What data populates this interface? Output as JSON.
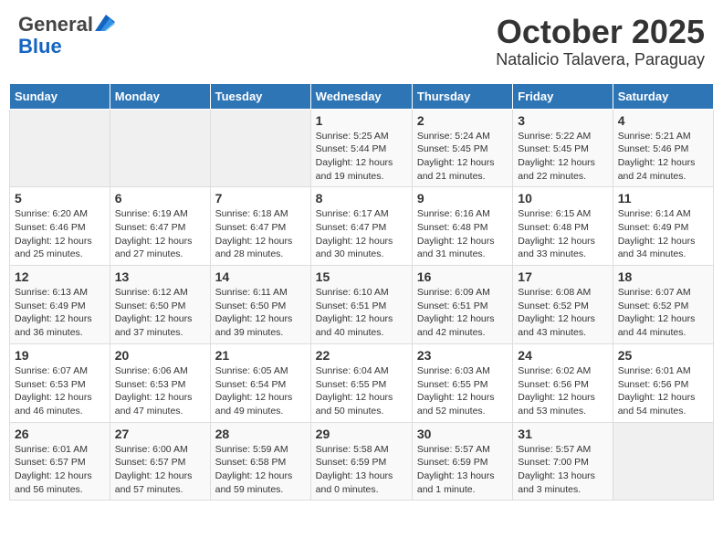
{
  "header": {
    "logo_general": "General",
    "logo_blue": "Blue",
    "title": "October 2025",
    "subtitle": "Natalicio Talavera, Paraguay"
  },
  "calendar": {
    "days_of_week": [
      "Sunday",
      "Monday",
      "Tuesday",
      "Wednesday",
      "Thursday",
      "Friday",
      "Saturday"
    ],
    "weeks": [
      [
        {
          "day": "",
          "info": ""
        },
        {
          "day": "",
          "info": ""
        },
        {
          "day": "",
          "info": ""
        },
        {
          "day": "1",
          "info": "Sunrise: 5:25 AM\nSunset: 5:44 PM\nDaylight: 12 hours\nand 19 minutes."
        },
        {
          "day": "2",
          "info": "Sunrise: 5:24 AM\nSunset: 5:45 PM\nDaylight: 12 hours\nand 21 minutes."
        },
        {
          "day": "3",
          "info": "Sunrise: 5:22 AM\nSunset: 5:45 PM\nDaylight: 12 hours\nand 22 minutes."
        },
        {
          "day": "4",
          "info": "Sunrise: 5:21 AM\nSunset: 5:46 PM\nDaylight: 12 hours\nand 24 minutes."
        }
      ],
      [
        {
          "day": "5",
          "info": "Sunrise: 6:20 AM\nSunset: 6:46 PM\nDaylight: 12 hours\nand 25 minutes."
        },
        {
          "day": "6",
          "info": "Sunrise: 6:19 AM\nSunset: 6:47 PM\nDaylight: 12 hours\nand 27 minutes."
        },
        {
          "day": "7",
          "info": "Sunrise: 6:18 AM\nSunset: 6:47 PM\nDaylight: 12 hours\nand 28 minutes."
        },
        {
          "day": "8",
          "info": "Sunrise: 6:17 AM\nSunset: 6:47 PM\nDaylight: 12 hours\nand 30 minutes."
        },
        {
          "day": "9",
          "info": "Sunrise: 6:16 AM\nSunset: 6:48 PM\nDaylight: 12 hours\nand 31 minutes."
        },
        {
          "day": "10",
          "info": "Sunrise: 6:15 AM\nSunset: 6:48 PM\nDaylight: 12 hours\nand 33 minutes."
        },
        {
          "day": "11",
          "info": "Sunrise: 6:14 AM\nSunset: 6:49 PM\nDaylight: 12 hours\nand 34 minutes."
        }
      ],
      [
        {
          "day": "12",
          "info": "Sunrise: 6:13 AM\nSunset: 6:49 PM\nDaylight: 12 hours\nand 36 minutes."
        },
        {
          "day": "13",
          "info": "Sunrise: 6:12 AM\nSunset: 6:50 PM\nDaylight: 12 hours\nand 37 minutes."
        },
        {
          "day": "14",
          "info": "Sunrise: 6:11 AM\nSunset: 6:50 PM\nDaylight: 12 hours\nand 39 minutes."
        },
        {
          "day": "15",
          "info": "Sunrise: 6:10 AM\nSunset: 6:51 PM\nDaylight: 12 hours\nand 40 minutes."
        },
        {
          "day": "16",
          "info": "Sunrise: 6:09 AM\nSunset: 6:51 PM\nDaylight: 12 hours\nand 42 minutes."
        },
        {
          "day": "17",
          "info": "Sunrise: 6:08 AM\nSunset: 6:52 PM\nDaylight: 12 hours\nand 43 minutes."
        },
        {
          "day": "18",
          "info": "Sunrise: 6:07 AM\nSunset: 6:52 PM\nDaylight: 12 hours\nand 44 minutes."
        }
      ],
      [
        {
          "day": "19",
          "info": "Sunrise: 6:07 AM\nSunset: 6:53 PM\nDaylight: 12 hours\nand 46 minutes."
        },
        {
          "day": "20",
          "info": "Sunrise: 6:06 AM\nSunset: 6:53 PM\nDaylight: 12 hours\nand 47 minutes."
        },
        {
          "day": "21",
          "info": "Sunrise: 6:05 AM\nSunset: 6:54 PM\nDaylight: 12 hours\nand 49 minutes."
        },
        {
          "day": "22",
          "info": "Sunrise: 6:04 AM\nSunset: 6:55 PM\nDaylight: 12 hours\nand 50 minutes."
        },
        {
          "day": "23",
          "info": "Sunrise: 6:03 AM\nSunset: 6:55 PM\nDaylight: 12 hours\nand 52 minutes."
        },
        {
          "day": "24",
          "info": "Sunrise: 6:02 AM\nSunset: 6:56 PM\nDaylight: 12 hours\nand 53 minutes."
        },
        {
          "day": "25",
          "info": "Sunrise: 6:01 AM\nSunset: 6:56 PM\nDaylight: 12 hours\nand 54 minutes."
        }
      ],
      [
        {
          "day": "26",
          "info": "Sunrise: 6:01 AM\nSunset: 6:57 PM\nDaylight: 12 hours\nand 56 minutes."
        },
        {
          "day": "27",
          "info": "Sunrise: 6:00 AM\nSunset: 6:57 PM\nDaylight: 12 hours\nand 57 minutes."
        },
        {
          "day": "28",
          "info": "Sunrise: 5:59 AM\nSunset: 6:58 PM\nDaylight: 12 hours\nand 59 minutes."
        },
        {
          "day": "29",
          "info": "Sunrise: 5:58 AM\nSunset: 6:59 PM\nDaylight: 13 hours\nand 0 minutes."
        },
        {
          "day": "30",
          "info": "Sunrise: 5:57 AM\nSunset: 6:59 PM\nDaylight: 13 hours\nand 1 minute."
        },
        {
          "day": "31",
          "info": "Sunrise: 5:57 AM\nSunset: 7:00 PM\nDaylight: 13 hours\nand 3 minutes."
        },
        {
          "day": "",
          "info": ""
        }
      ]
    ]
  }
}
